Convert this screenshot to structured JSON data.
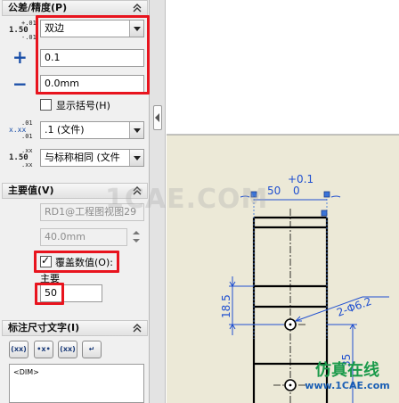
{
  "tolerance_section": {
    "title": "公差/精度(P)",
    "icon_top_labels": [
      "+.01",
      "1.50",
      "-.01"
    ],
    "type_value": "双边",
    "plus_icon": "+",
    "minus_icon": "−",
    "upper_value": "0.1",
    "lower_value": "0.0mm",
    "show_parentheses_label": "显示括号(H)",
    "precision_icon_labels": [
      ".01",
      "x.xx",
      ".01"
    ],
    "precision_value": ".1 (文件)",
    "tol_precision_icon_labels": [
      ".xx",
      "1.50",
      ".xx"
    ],
    "tol_precision_value": "与标称相同 (文件"
  },
  "primary_section": {
    "title": "主要值(V)",
    "dim_name": "RD1@工程图视图29",
    "dim_value": "40.0mm",
    "override_label": "覆盖数值(O):",
    "primary_label": "主要",
    "override_value": "50"
  },
  "dimtext_section": {
    "title": "标注尺寸文字(I)",
    "buttons": [
      "(xx)",
      "•x•",
      "(xx)",
      "↵"
    ],
    "text_value": "<DIM>"
  },
  "drawing": {
    "tol_upper": "+0.1",
    "dim_main": "50",
    "tol_lower": "0",
    "dim_height": "18.5",
    "dim_diameter": "2-Φ6.2",
    "dim_side": "35"
  },
  "watermark": {
    "center_text": "1CAE.COM",
    "brand_text": "仿真在线",
    "brand_url": "www.1CAE.com"
  },
  "colors": {
    "accent_red": "#e8141e",
    "dim_blue": "#1f4fd0",
    "brand_green": "#1a9a4a"
  }
}
